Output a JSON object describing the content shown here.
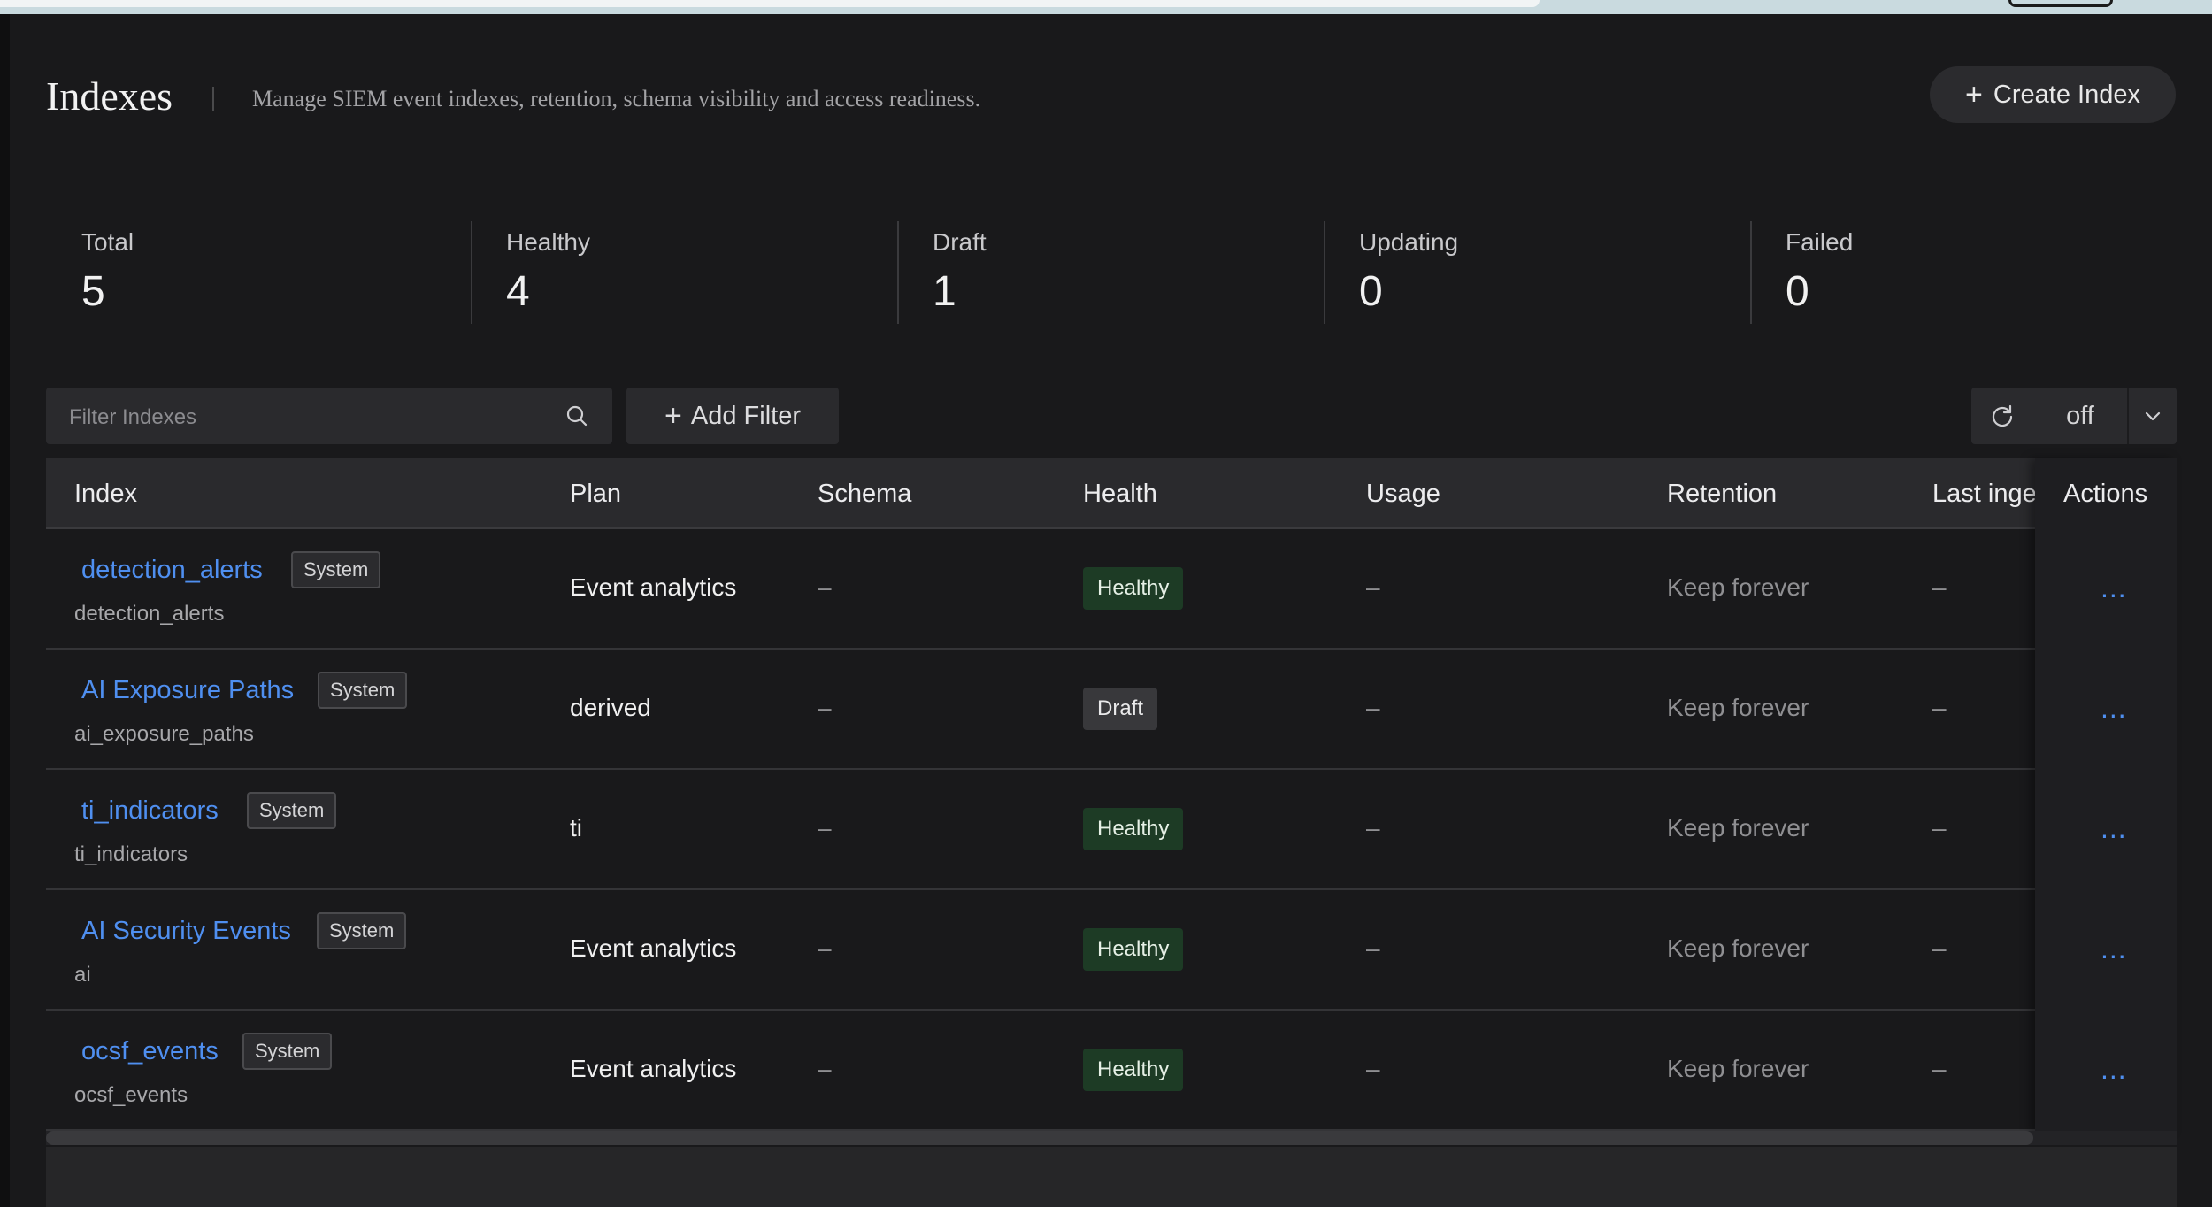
{
  "page": {
    "title": "Indexes",
    "subtitle": "Manage SIEM event indexes, retention, schema visibility and access readiness.",
    "create_button": "Create Index"
  },
  "stats": [
    {
      "label": "Total",
      "value": "5"
    },
    {
      "label": "Healthy",
      "value": "4"
    },
    {
      "label": "Draft",
      "value": "1"
    },
    {
      "label": "Updating",
      "value": "0"
    },
    {
      "label": "Failed",
      "value": "0"
    }
  ],
  "toolbar": {
    "filter_placeholder": "Filter Indexes",
    "add_filter": "Add Filter",
    "refresh_interval": "off"
  },
  "table": {
    "columns": [
      "Index",
      "Plan",
      "Schema",
      "Health",
      "Usage",
      "Retention",
      "Last inge",
      "Actions"
    ],
    "rows": [
      {
        "name": "detection_alerts",
        "badge": "System",
        "id": "detection_alerts",
        "plan": "Event analytics",
        "schema": "–",
        "health": "Healthy",
        "usage": "–",
        "retention": "Keep forever",
        "last_ingest": "–",
        "actions": "..."
      },
      {
        "name": "AI Exposure Paths",
        "badge": "System",
        "id": "ai_exposure_paths",
        "plan": "derived",
        "schema": "–",
        "health": "Draft",
        "usage": "–",
        "retention": "Keep forever",
        "last_ingest": "–",
        "actions": "..."
      },
      {
        "name": "ti_indicators",
        "badge": "System",
        "id": "ti_indicators",
        "plan": "ti",
        "schema": "–",
        "health": "Healthy",
        "usage": "–",
        "retention": "Keep forever",
        "last_ingest": "–",
        "actions": "..."
      },
      {
        "name": "AI Security Events",
        "badge": "System",
        "id": "ai",
        "plan": "Event analytics",
        "schema": "–",
        "health": "Healthy",
        "usage": "–",
        "retention": "Keep forever",
        "last_ingest": "–",
        "actions": "..."
      },
      {
        "name": "ocsf_events",
        "badge": "System",
        "id": "ocsf_events",
        "plan": "Event analytics",
        "schema": "–",
        "health": "Healthy",
        "usage": "–",
        "retention": "Keep forever",
        "last_ingest": "–",
        "actions": "..."
      }
    ]
  },
  "colors": {
    "link": "#4f8ff0",
    "healthy_bg": "#1d3b25",
    "draft_bg": "#38383b",
    "background": "#19191b"
  }
}
